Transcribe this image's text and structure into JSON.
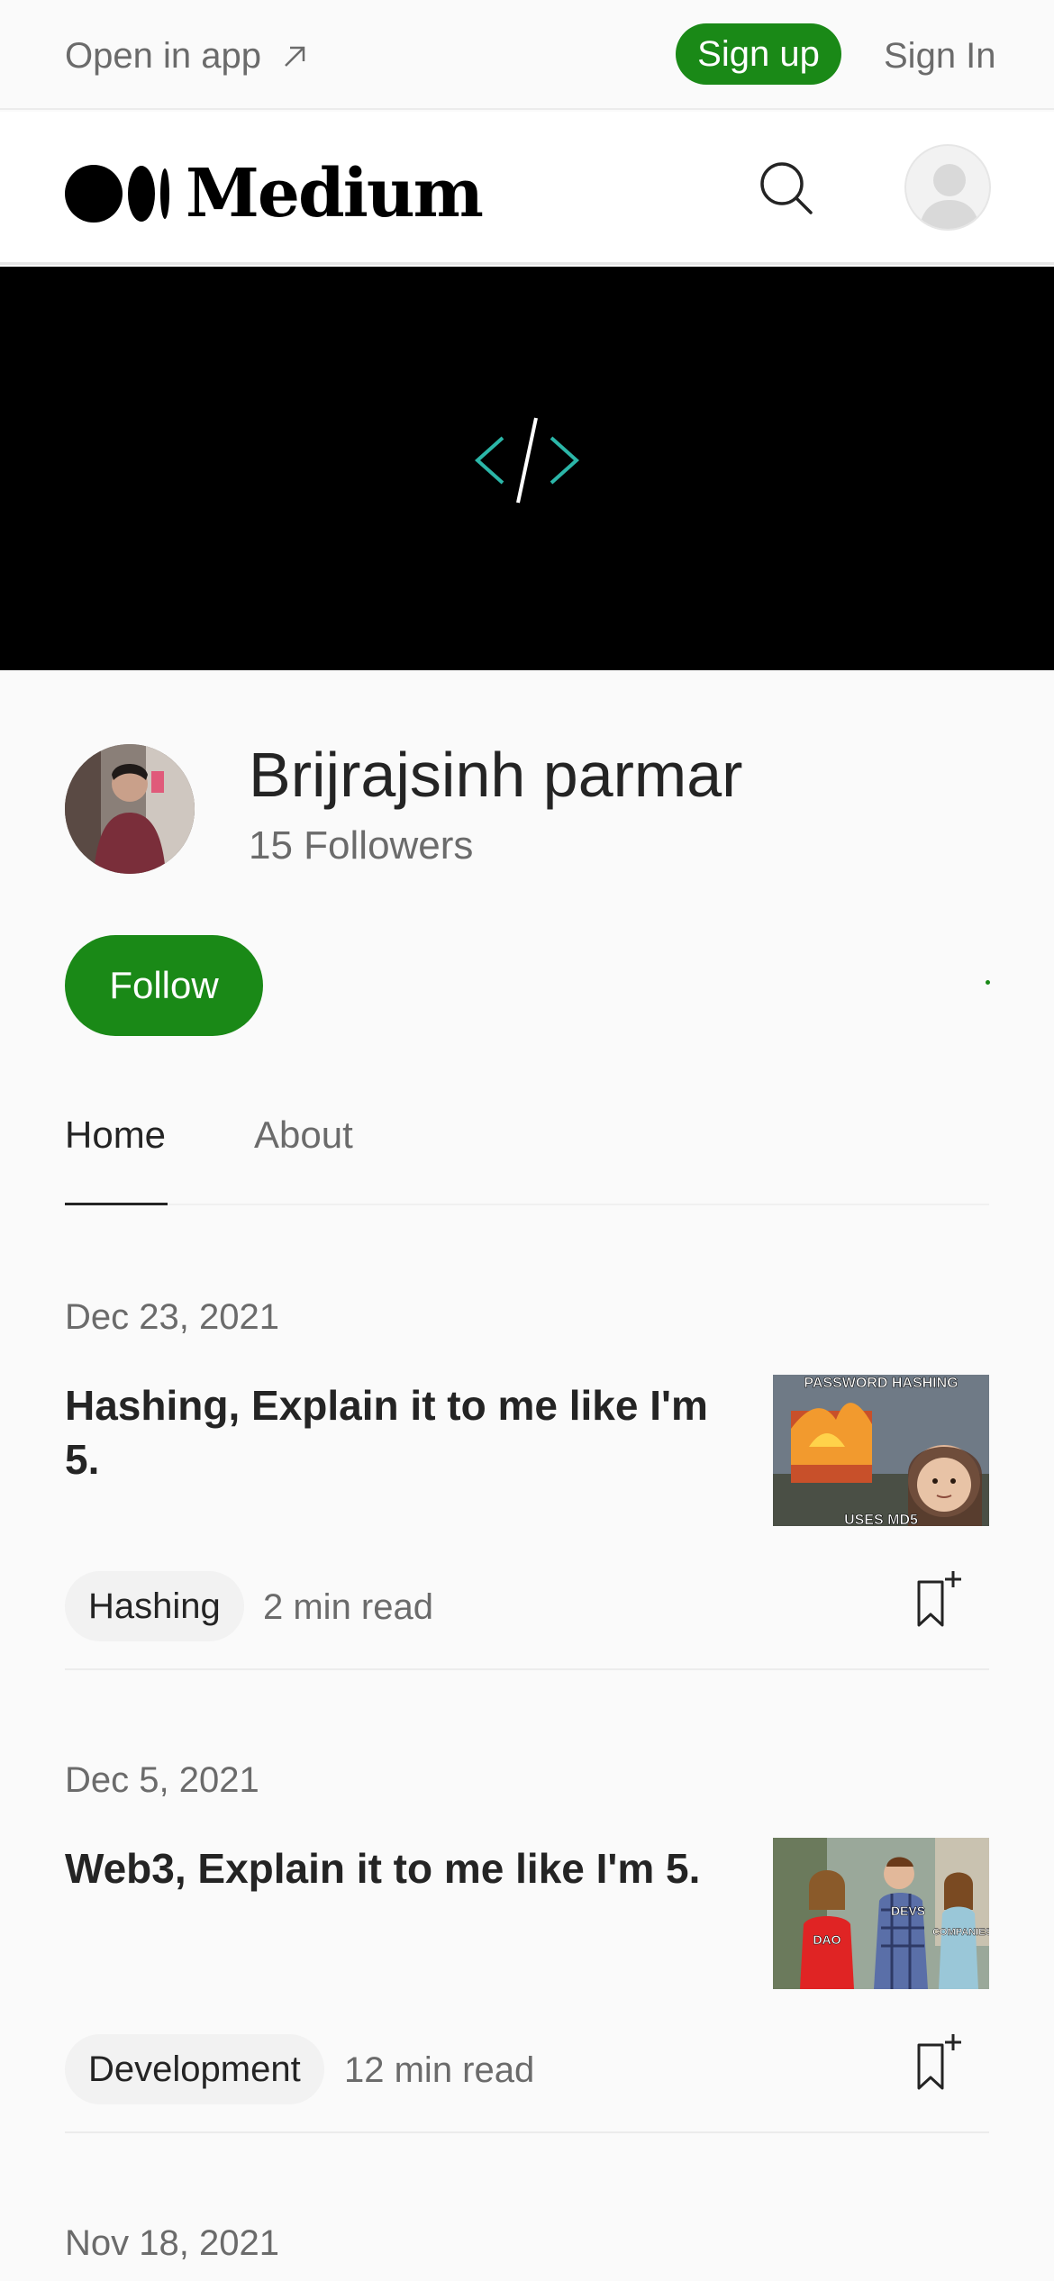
{
  "topbar": {
    "open_in_app": "Open in app",
    "sign_up": "Sign up",
    "sign_in": "Sign In"
  },
  "header": {
    "brand": "Medium"
  },
  "profile": {
    "name": "Brijrajsinh parmar",
    "followers": "15 Followers",
    "follow_label": "Follow"
  },
  "tabs": [
    {
      "label": "Home",
      "active": true
    },
    {
      "label": "About",
      "active": false
    }
  ],
  "articles": [
    {
      "date": "Dec 23, 2021",
      "title": "Hashing, Explain it to me like I'm 5.",
      "tag": "Hashing",
      "read_time": "2 min read",
      "thumb_text_top": "PASSWORD HASHING",
      "thumb_text_bottom": "USES MD5"
    },
    {
      "date": "Dec 5, 2021",
      "title": "Web3, Explain it to me like I'm 5.",
      "tag": "Development",
      "read_time": "12 min read",
      "thumb_label_1": "DAO",
      "thumb_label_2": "DEVS",
      "thumb_label_3": "COMPANIES"
    },
    {
      "date": "Nov 18, 2021"
    }
  ],
  "colors": {
    "accent_green": "#1a8917",
    "text_primary": "#242424",
    "text_secondary": "#6b6b6b",
    "banner_bg": "#000000",
    "code_icon_teal": "#2bb6a8"
  },
  "icons": [
    "arrow-up-right-icon",
    "search-icon",
    "user-avatar-icon",
    "code-brackets-icon",
    "bookmark-add-icon"
  ]
}
